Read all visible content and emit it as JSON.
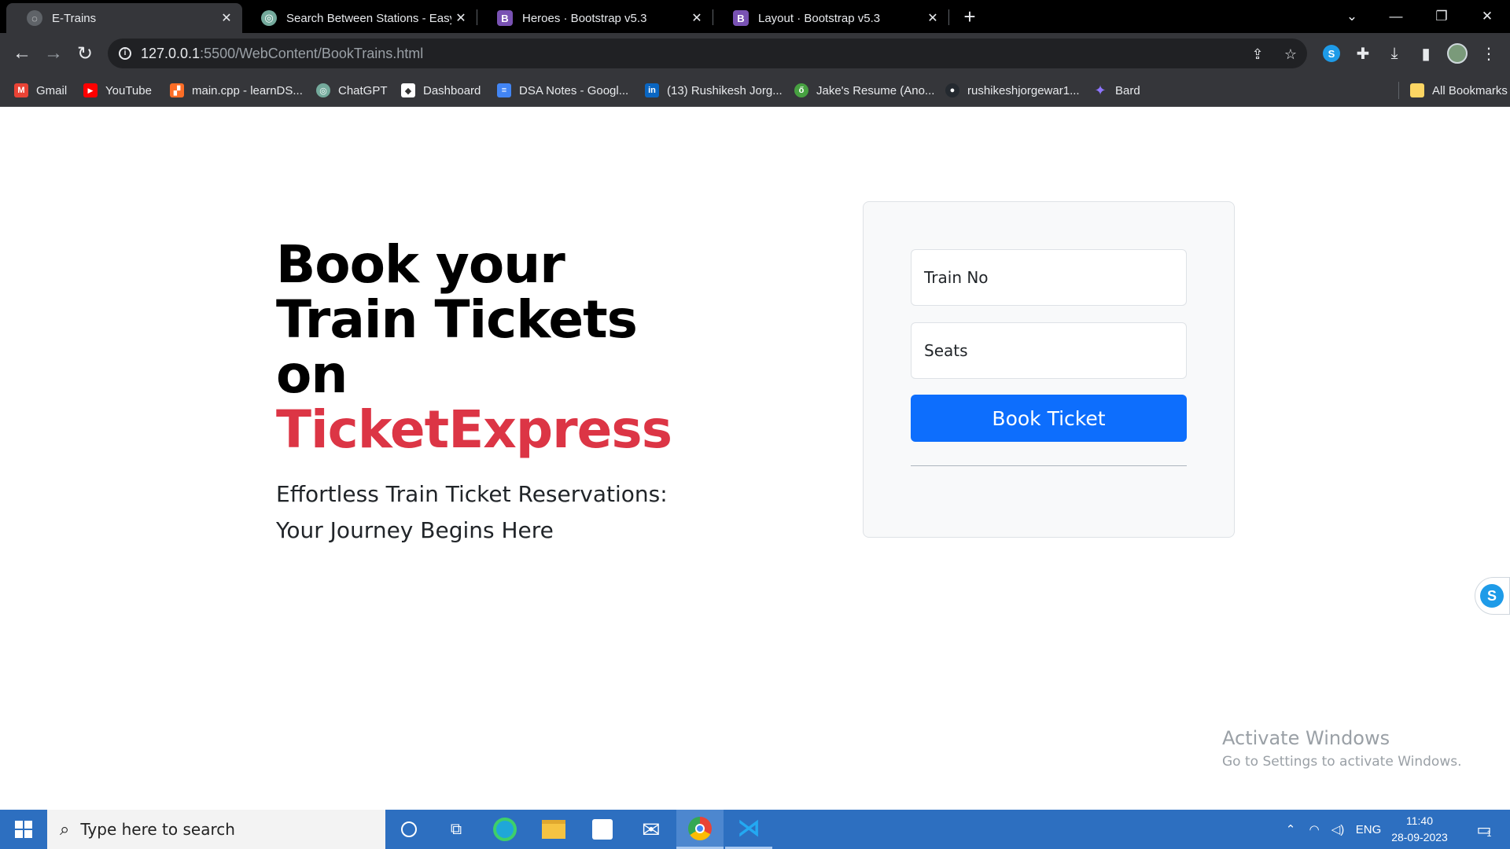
{
  "browser": {
    "tabs": [
      {
        "title": "E-Trains",
        "active": true,
        "favicon": "globe-icon",
        "color": "#5f6368"
      },
      {
        "title": "Search Between Stations - Easy",
        "active": false,
        "favicon": "chatgpt-icon",
        "color": "#74aa9c"
      },
      {
        "title": "Heroes · Bootstrap v5.3",
        "active": false,
        "favicon": "bootstrap-icon",
        "color": "#7952b3"
      },
      {
        "title": "Layout · Bootstrap v5.3",
        "active": false,
        "favicon": "bootstrap-icon",
        "color": "#7952b3"
      }
    ],
    "url_host": "127.0.0.1",
    "url_path": ":5500/WebContent/BookTrains.html",
    "bookmarks": [
      {
        "label": "Gmail",
        "icon": "gmail-icon",
        "color": "#ea4335",
        "glyph": "M"
      },
      {
        "label": "YouTube",
        "icon": "youtube-icon",
        "color": "#ff0000",
        "glyph": "▶"
      },
      {
        "label": "main.cpp - learnDS...",
        "icon": "gitlab-icon",
        "color": "#fc6d26",
        "glyph": "▞"
      },
      {
        "label": "ChatGPT",
        "icon": "chatgpt-icon",
        "color": "#74aa9c",
        "glyph": "◎"
      },
      {
        "label": "Dashboard",
        "icon": "dashboard-icon",
        "color": "#ffffff",
        "glyph": "◆"
      },
      {
        "label": "DSA Notes - Googl...",
        "icon": "google-docs-icon",
        "color": "#4285f4",
        "glyph": "≡"
      },
      {
        "label": "(13) Rushikesh Jorg...",
        "icon": "linkedin-icon",
        "color": "#0a66c2",
        "glyph": "in"
      },
      {
        "label": "Jake's Resume (Ano...",
        "icon": "overleaf-icon",
        "color": "#47a141",
        "glyph": "ő"
      },
      {
        "label": "rushikeshjorgewar1...",
        "icon": "github-icon",
        "color": "#24292f",
        "glyph": "●"
      },
      {
        "label": "Bard",
        "icon": "bard-icon",
        "color": "#8e75ff",
        "glyph": "✦"
      }
    ],
    "all_bookmarks": "All Bookmarks"
  },
  "hero": {
    "title_line": "Book your Train Tickets on",
    "title_accent": "TicketExpress",
    "lead": "Effortless Train Ticket Reservations: Your Journey Begins Here",
    "accent_color": "#dc3545"
  },
  "form": {
    "train_no_placeholder": "Train No",
    "seats_placeholder": "Seats",
    "submit_label": "Book Ticket",
    "button_color": "#0d6efd"
  },
  "watermark": {
    "line1": "Activate Windows",
    "line2": "Go to Settings to activate Windows."
  },
  "taskbar": {
    "search_placeholder": "Type here to search",
    "language": "ENG",
    "time": "11:40",
    "date": "28-09-2023",
    "notification_count": "1"
  }
}
